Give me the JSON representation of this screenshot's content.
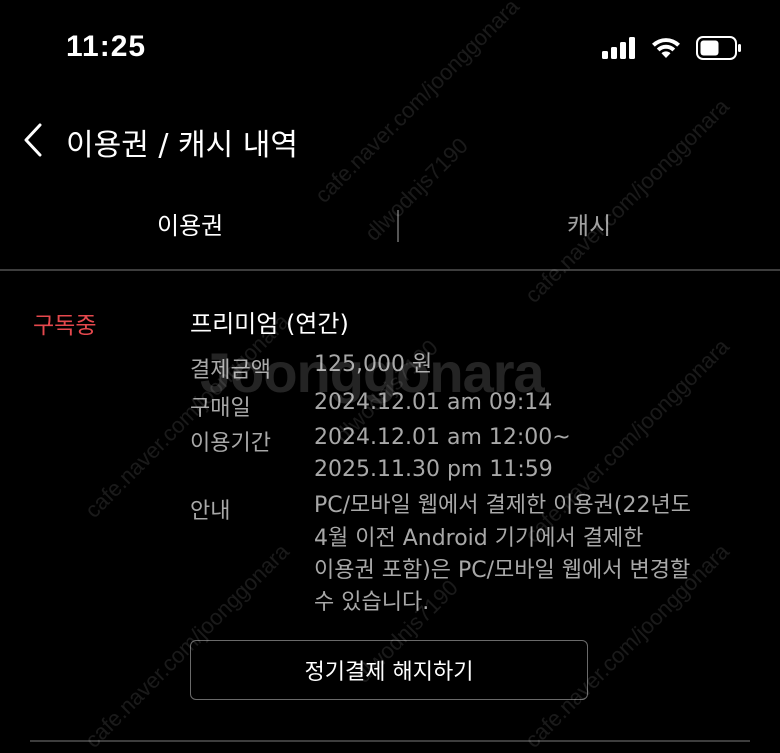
{
  "status_bar": {
    "time": "11:25"
  },
  "header": {
    "title": "이용권 / 캐시 내역"
  },
  "tabs": [
    {
      "label": "이용권",
      "active": true
    },
    {
      "label": "캐시",
      "active": false
    }
  ],
  "subscription": {
    "status": "구독중",
    "plan": "프리미엄 (연간)",
    "rows": [
      {
        "label": "결제금액",
        "lines": [
          "125,000 원"
        ]
      },
      {
        "label": "구매일",
        "lines": [
          "2024.12.01 am 09:14"
        ]
      },
      {
        "label": "이용기간",
        "lines": [
          "2024.12.01 am 12:00~",
          "2025.11.30 pm 11:59"
        ]
      },
      {
        "label": "안내",
        "lines": [
          "PC/모바일 웹에서 결제한 이용권(22년도",
          "4월 이전 Android 기기에서 결제한",
          "이용권 포함)은 PC/모바일 웹에서 변경할",
          "수 있습니다."
        ]
      }
    ],
    "cancel_button": "정기결제 해지하기"
  },
  "watermarks": {
    "main": "Joonggonara",
    "diagonals": [
      "cafe.naver.com/joonggonara",
      "dlwodnjs7190"
    ]
  },
  "colors": {
    "background": "#000000",
    "accent_status": "#e5484d",
    "muted_text": "#a8a8a8"
  }
}
